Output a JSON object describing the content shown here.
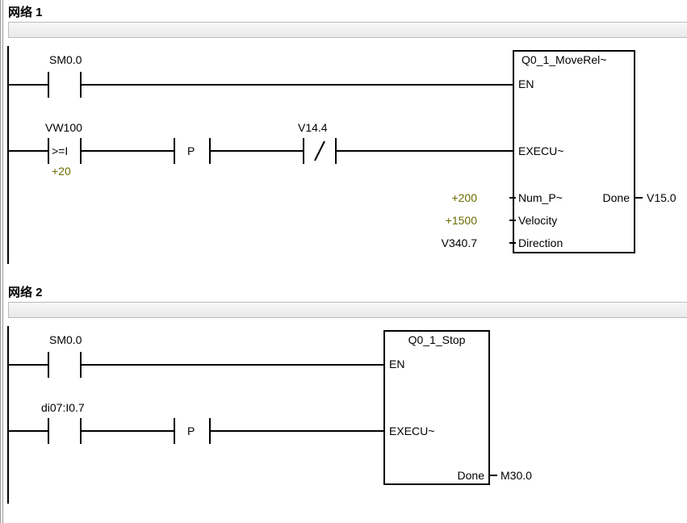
{
  "networks": [
    {
      "title": "网络 1",
      "rung1": {
        "contact1": {
          "label": "SM0.0"
        }
      },
      "rung2": {
        "compare": {
          "label": "VW100",
          "op": ">=I",
          "value": "+20"
        },
        "pulse": {
          "label": "P"
        },
        "nc": {
          "label": "V14.4"
        }
      },
      "block": {
        "title": "Q0_1_MoveRel~",
        "en": "EN",
        "execu": "EXECU~",
        "num_p_label": "Num_P~",
        "num_p_val": "+200",
        "velocity_label": "Velocity",
        "velocity_val": "+1500",
        "direction_label": "Direction",
        "direction_val": "V340.7",
        "done_label": "Done",
        "done_out": "V15.0"
      }
    },
    {
      "title": "网络 2",
      "rung1": {
        "contact1": {
          "label": "SM0.0"
        }
      },
      "rung2": {
        "contact1": {
          "label": "di07:I0.7"
        },
        "pulse": {
          "label": "P"
        }
      },
      "block": {
        "title": "Q0_1_Stop",
        "en": "EN",
        "execu": "EXECU~",
        "done_label": "Done",
        "done_out": "M30.0"
      }
    }
  ]
}
